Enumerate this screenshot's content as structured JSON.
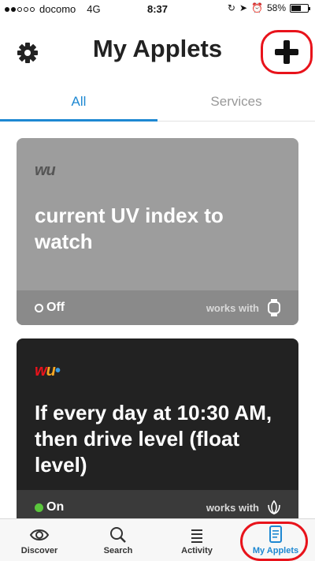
{
  "status_bar": {
    "carrier": "docomo",
    "network": "4G",
    "time": "8:37",
    "battery": "58%",
    "battery_level": 0.58
  },
  "header": {
    "title": "My Applets",
    "settings_icon": "gear-icon",
    "add_icon": "plus-icon",
    "highlight_color": "#e8131b"
  },
  "tabs": [
    {
      "label": "All",
      "active": true
    },
    {
      "label": "Services",
      "active": false
    }
  ],
  "applets": [
    {
      "logo": "wu",
      "title": "current UV index to watch",
      "status": "Off",
      "works_with": "works with",
      "service_icon": "watch-icon",
      "background": "#9d9d9d"
    },
    {
      "logo": "wu",
      "title": "If every day at 10:30 AM, then drive level (float level)",
      "status": "On",
      "works_with": "works with",
      "service_icon": "flower-icon",
      "background": "#222222"
    }
  ],
  "bottom_nav": [
    {
      "label": "Discover",
      "icon": "eye-icon",
      "active": false
    },
    {
      "label": "Search",
      "icon": "search-icon",
      "active": false
    },
    {
      "label": "Activity",
      "icon": "list-icon",
      "active": false
    },
    {
      "label": "My Applets",
      "icon": "document-icon",
      "active": true
    }
  ],
  "colors": {
    "accent": "#1e88d2",
    "on_status": "#5ac63c"
  }
}
